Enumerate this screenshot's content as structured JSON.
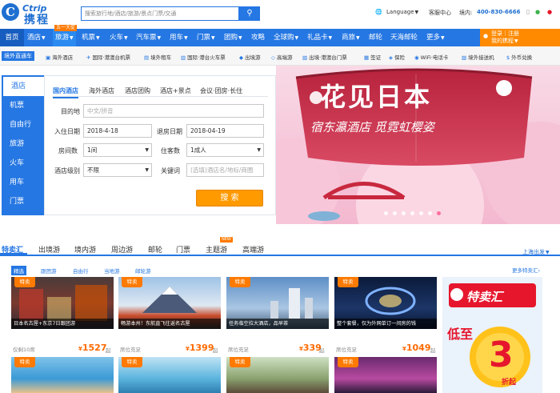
{
  "header": {
    "logo_mark": "C",
    "logo_en": "Ctrip",
    "logo_cn": "携程",
    "search_placeholder": "搜索旅行地/酒店/旅游/景点门票/交通",
    "language": "Language",
    "service": "客服中心",
    "domestic": "境内:",
    "phone": "400-830-6666"
  },
  "nav": {
    "items": [
      "首页",
      "酒店",
      "旅游",
      "机票",
      "火车",
      "汽车票",
      "用车",
      "门票",
      "团购",
      "攻略",
      "全球购",
      "礼品卡",
      "商旅",
      "邮轮",
      "天海邮轮",
      "更多"
    ],
    "badge": "五一大促",
    "login": "登录｜注册",
    "my_ctrip": "我的携程"
  },
  "subnav": {
    "tag": "境外直通车",
    "items": [
      "海外酒店",
      "国际·港澳台机票",
      "境外租车",
      "国际·港台火车票",
      "出境游",
      "高端游",
      "出境·港澳台门票",
      "签证",
      "保险",
      "WiFi·电话卡",
      "境外接送机",
      "外币兑换"
    ]
  },
  "categories": [
    "酒店",
    "机票",
    "自由行",
    "旅游",
    "火车",
    "用车",
    "门票"
  ],
  "booking": {
    "tabs": [
      "国内酒店",
      "海外酒店",
      "酒店团购",
      "酒店+景点",
      "会议·团房·长住"
    ],
    "dest_label": "目的地",
    "dest_placeholder": "中文/拼音",
    "checkin_label": "入住日期",
    "checkin": "2018-4-18",
    "checkout_label": "退房日期",
    "checkout": "2018-04-19",
    "rooms_label": "房间数",
    "rooms": "1间",
    "guests_label": "住客数",
    "guests": "1成人",
    "level_label": "酒店级别",
    "level": "不限",
    "keyword_label": "关键词",
    "keyword_placeholder": "(选填)酒店名/地标/商圈",
    "submit": "搜 索"
  },
  "banner": {
    "title": "花见日本",
    "subtitle": "宿东瀛酒店 觅霓虹樱姿"
  },
  "section": {
    "tabs": [
      "特卖汇",
      "出境游",
      "境内游",
      "周边游",
      "邮轮",
      "门票",
      "主题游",
      "高端游"
    ],
    "new_badge": "NEW",
    "city": "上海出发",
    "filters": [
      "精选",
      "跟团游",
      "自由行",
      "当地游",
      "邮轮游"
    ],
    "more": "更多特卖汇"
  },
  "cards": [
    {
      "tag": "特卖",
      "caption": "日本名古屋+东京7日跟团游",
      "meta": "仅剩10席",
      "price": "1527",
      "suffix": "起"
    },
    {
      "tag": "特卖",
      "caption": "畅游本州！东航直飞往返名古屋",
      "meta": "席位充足",
      "price": "1399",
      "suffix": "起"
    },
    {
      "tag": "特卖",
      "caption": "任务临空拉大酒店，品早茶",
      "meta": "席位充足",
      "price": "339",
      "suffix": "起"
    },
    {
      "tag": "特卖",
      "caption": "整个套餐，仅为外网单订一间房的钱",
      "meta": "席位充足",
      "price": "1049",
      "suffix": "起"
    },
    {
      "tag": "特卖",
      "caption": "",
      "meta": "",
      "price": "",
      "suffix": ""
    },
    {
      "tag": "特卖",
      "caption": "",
      "meta": "",
      "price": "",
      "suffix": ""
    },
    {
      "tag": "特卖",
      "caption": "",
      "meta": "",
      "price": "",
      "suffix": ""
    },
    {
      "tag": "特卖",
      "caption": "",
      "meta": "",
      "price": "",
      "suffix": ""
    }
  ],
  "promo": {
    "title": "特卖汇",
    "low": "低至",
    "number": "3",
    "unit": "折起"
  }
}
